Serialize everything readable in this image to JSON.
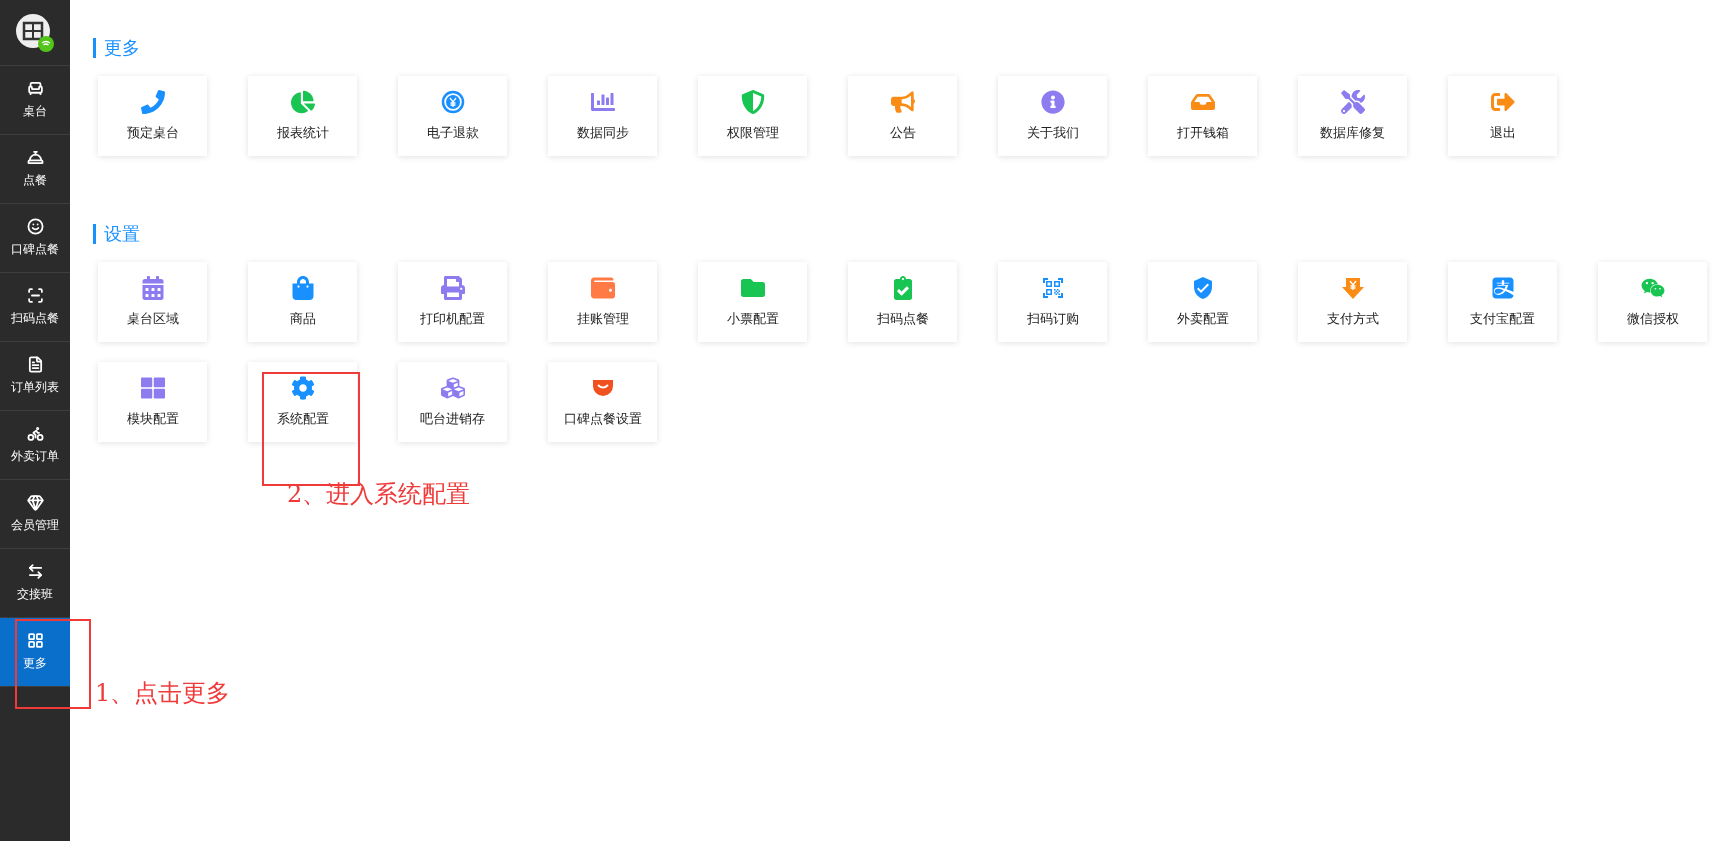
{
  "sidebar": {
    "items": [
      {
        "label": "桌台",
        "selected": false
      },
      {
        "label": "点餐",
        "selected": false
      },
      {
        "label": "口碑点餐",
        "selected": false
      },
      {
        "label": "扫码点餐",
        "selected": false
      },
      {
        "label": "订单列表",
        "selected": false
      },
      {
        "label": "外卖订单",
        "selected": false
      },
      {
        "label": "会员管理",
        "selected": false
      },
      {
        "label": "交接班",
        "selected": false
      },
      {
        "label": "更多",
        "selected": true
      }
    ]
  },
  "sections": [
    {
      "title": "更多",
      "tiles": [
        {
          "label": "预定桌台"
        },
        {
          "label": "报表统计"
        },
        {
          "label": "电子退款"
        },
        {
          "label": "数据同步"
        },
        {
          "label": "权限管理"
        },
        {
          "label": "公告"
        },
        {
          "label": "关于我们"
        },
        {
          "label": "打开钱箱"
        },
        {
          "label": "数据库修复"
        },
        {
          "label": "退出"
        }
      ]
    },
    {
      "title": "设置",
      "tiles": [
        {
          "label": "桌台区域"
        },
        {
          "label": "商品"
        },
        {
          "label": "打印机配置"
        },
        {
          "label": "挂账管理"
        },
        {
          "label": "小票配置"
        },
        {
          "label": "扫码点餐"
        },
        {
          "label": "扫码订购"
        },
        {
          "label": "外卖配置"
        },
        {
          "label": "支付方式"
        },
        {
          "label": "支付宝配置"
        },
        {
          "label": "微信授权"
        },
        {
          "label": "模块配置"
        },
        {
          "label": "系统配置"
        },
        {
          "label": "吧台进销存"
        },
        {
          "label": "口碑点餐设置"
        }
      ]
    }
  ],
  "annotations": [
    {
      "text": "1、点击更多"
    },
    {
      "text": "2、进入系统配置"
    }
  ]
}
